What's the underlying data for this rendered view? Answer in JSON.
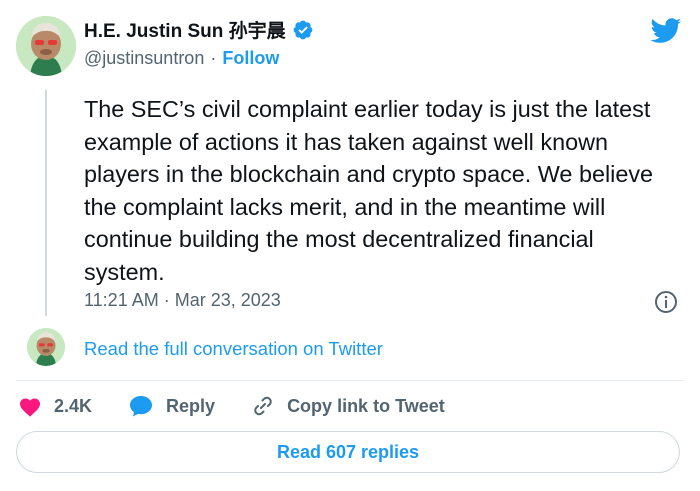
{
  "author": {
    "name": "H.E. Justin Sun 孙宇晨",
    "handle": "@justinsuntron",
    "separator": "·",
    "follow_label": "Follow",
    "verified": true
  },
  "tweet": {
    "text": "The SEC’s civil complaint earlier today is just the latest example of actions it has taken against well known players in the blockchain and crypto space. We believe the complaint lacks merit, and in the meantime will continue building the most decentralized financial system.",
    "timestamp": "11:21 AM · Mar 23, 2023"
  },
  "conversation": {
    "read_full_label": "Read the full conversation on Twitter"
  },
  "actions": {
    "likes": "2.4K",
    "reply_label": "Reply",
    "copy_link_label": "Copy link to Tweet"
  },
  "replies": {
    "read_replies_label": "Read 607 replies"
  },
  "icons": {
    "brand": "twitter-bird-icon",
    "verified": "verified-badge-icon",
    "info": "info-icon",
    "like": "heart-icon",
    "reply": "reply-bubble-icon",
    "copy_link": "link-icon"
  },
  "colors": {
    "accent": "#1d9bf0",
    "like": "#f91880",
    "text": "#0f1419",
    "secondary": "#536471"
  }
}
